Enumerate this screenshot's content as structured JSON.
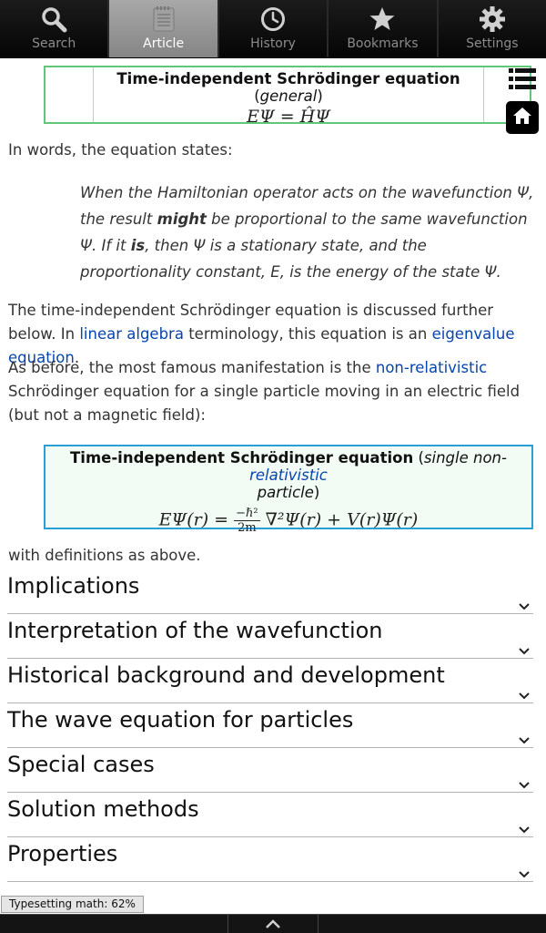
{
  "tabs": [
    {
      "label": "Search",
      "icon": "search-icon",
      "active": false
    },
    {
      "label": "Article",
      "icon": "article-icon",
      "active": true
    },
    {
      "label": "History",
      "icon": "clock-icon",
      "active": false
    },
    {
      "label": "Bookmarks",
      "icon": "star-icon",
      "active": false
    },
    {
      "label": "Settings",
      "icon": "gear-icon",
      "active": false
    }
  ],
  "eq1": {
    "title": "Time-independent Schrödinger equation",
    "qualifier": "general",
    "math_lhs": "EΨ",
    "math_eq": "=",
    "math_rhs": "ĤΨ"
  },
  "intro": "In words, the equation states:",
  "quote": {
    "part1": "When the Hamiltonian operator acts on the wavefunction Ψ, the result ",
    "strong1": "might",
    "part2": " be proportional to the same wavefunction Ψ. If it ",
    "strong2": "is",
    "part3": ", then Ψ is a stationary state, and the proportionality constant, E, is the energy of the state Ψ."
  },
  "para2": {
    "text1": "The time-independent Schrödinger equation is discussed further below. In ",
    "link1": "linear algebra",
    "text2": " terminology, this equation is an ",
    "link2": "eigenvalue equation",
    "text3": "."
  },
  "para3": {
    "text1": "As before, the most famous manifestation is the ",
    "link1": "non-relativistic",
    "text2": " Schrödinger equation for a single particle moving in an electric field (but not a magnetic field):"
  },
  "eq2": {
    "title": "Time-independent Schrödinger equation",
    "qual_pre": "single non-",
    "qual_link": "relativistic",
    "qual_post": "particle",
    "frac_num": "−ℏ²",
    "frac_den": "2m",
    "math_lhs": "EΨ(r) =",
    "math_rhs": "∇²Ψ(r) + V(r)Ψ(r)"
  },
  "defs": "with definitions as above.",
  "sections": [
    "Implications",
    "Interpretation of the wavefunction",
    "Historical background and development",
    "The wave equation for particles",
    "Special cases",
    "Solution methods",
    "Properties"
  ],
  "status": "Typesetting math: 62%",
  "colors": {
    "eq1_border": "#5ec77a",
    "eq2_border": "#2a9fd6",
    "link": "#0645ad",
    "tab_active": "#9a9a9a"
  }
}
